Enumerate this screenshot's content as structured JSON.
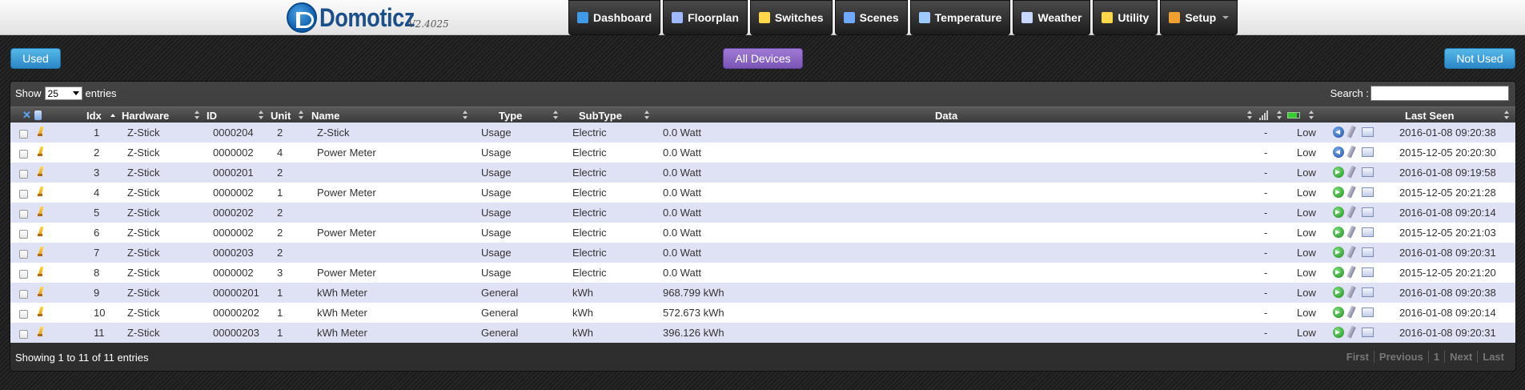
{
  "brand": {
    "name": "Domoticz",
    "version": "V2.4025"
  },
  "nav": [
    {
      "label": "Dashboard",
      "icon": "dashboard-icon",
      "color": "#3f9be8"
    },
    {
      "label": "Floorplan",
      "icon": "floorplan-icon",
      "color": "#9fb8ff"
    },
    {
      "label": "Switches",
      "icon": "switches-icon",
      "color": "#ffd84a"
    },
    {
      "label": "Scenes",
      "icon": "scenes-icon",
      "color": "#6fa8ff"
    },
    {
      "label": "Temperature",
      "icon": "temperature-icon",
      "color": "#9ecbff"
    },
    {
      "label": "Weather",
      "icon": "weather-icon",
      "color": "#c8d8ff"
    },
    {
      "label": "Utility",
      "icon": "utility-icon",
      "color": "#ffd84a"
    },
    {
      "label": "Setup",
      "icon": "setup-icon",
      "color": "#f0a030"
    }
  ],
  "buttons": {
    "used": "Used",
    "all": "All Devices",
    "not_used": "Not Used"
  },
  "table_controls": {
    "show": "Show",
    "entries_value": "25",
    "entries": "entries",
    "search": "Search :"
  },
  "columns": {
    "idx": "Idx",
    "hardware": "Hardware",
    "id": "ID",
    "unit": "Unit",
    "name": "Name",
    "type": "Type",
    "subtype": "SubType",
    "data": "Data",
    "last_seen": "Last Seen"
  },
  "rows": [
    {
      "idx": "1",
      "hardware": "Z-Stick",
      "id": "0000204",
      "unit": "2",
      "name": "Z-Stick",
      "type": "Usage",
      "subtype": "Electric",
      "data": "0.0 Watt",
      "signal": "-",
      "battery": "Low",
      "arrow": "blue",
      "last_seen": "2016-01-08 09:20:38"
    },
    {
      "idx": "2",
      "hardware": "Z-Stick",
      "id": "0000002",
      "unit": "4",
      "name": "Power Meter",
      "type": "Usage",
      "subtype": "Electric",
      "data": "0.0 Watt",
      "signal": "-",
      "battery": "Low",
      "arrow": "blue",
      "last_seen": "2015-12-05 20:20:30"
    },
    {
      "idx": "3",
      "hardware": "Z-Stick",
      "id": "0000201",
      "unit": "2",
      "name": "",
      "type": "Usage",
      "subtype": "Electric",
      "data": "0.0 Watt",
      "signal": "-",
      "battery": "Low",
      "arrow": "green",
      "last_seen": "2016-01-08 09:19:58"
    },
    {
      "idx": "4",
      "hardware": "Z-Stick",
      "id": "0000002",
      "unit": "1",
      "name": "Power Meter",
      "type": "Usage",
      "subtype": "Electric",
      "data": "0.0 Watt",
      "signal": "-",
      "battery": "Low",
      "arrow": "green",
      "last_seen": "2015-12-05 20:21:28"
    },
    {
      "idx": "5",
      "hardware": "Z-Stick",
      "id": "0000202",
      "unit": "2",
      "name": "",
      "type": "Usage",
      "subtype": "Electric",
      "data": "0.0 Watt",
      "signal": "-",
      "battery": "Low",
      "arrow": "green",
      "last_seen": "2016-01-08 09:20:14"
    },
    {
      "idx": "6",
      "hardware": "Z-Stick",
      "id": "0000002",
      "unit": "2",
      "name": "Power Meter",
      "type": "Usage",
      "subtype": "Electric",
      "data": "0.0 Watt",
      "signal": "-",
      "battery": "Low",
      "arrow": "green",
      "last_seen": "2015-12-05 20:21:03"
    },
    {
      "idx": "7",
      "hardware": "Z-Stick",
      "id": "0000203",
      "unit": "2",
      "name": "",
      "type": "Usage",
      "subtype": "Electric",
      "data": "0.0 Watt",
      "signal": "-",
      "battery": "Low",
      "arrow": "green",
      "last_seen": "2016-01-08 09:20:31"
    },
    {
      "idx": "8",
      "hardware": "Z-Stick",
      "id": "0000002",
      "unit": "3",
      "name": "Power Meter",
      "type": "Usage",
      "subtype": "Electric",
      "data": "0.0 Watt",
      "signal": "-",
      "battery": "Low",
      "arrow": "green",
      "last_seen": "2015-12-05 20:21:20"
    },
    {
      "idx": "9",
      "hardware": "Z-Stick",
      "id": "00000201",
      "unit": "1",
      "name": "kWh Meter",
      "type": "General",
      "subtype": "kWh",
      "data": "968.799 kWh",
      "signal": "-",
      "battery": "Low",
      "arrow": "green",
      "last_seen": "2016-01-08 09:20:38"
    },
    {
      "idx": "10",
      "hardware": "Z-Stick",
      "id": "00000202",
      "unit": "1",
      "name": "kWh Meter",
      "type": "General",
      "subtype": "kWh",
      "data": "572.673 kWh",
      "signal": "-",
      "battery": "Low",
      "arrow": "green",
      "last_seen": "2016-01-08 09:20:14"
    },
    {
      "idx": "11",
      "hardware": "Z-Stick",
      "id": "00000203",
      "unit": "1",
      "name": "kWh Meter",
      "type": "General",
      "subtype": "kWh",
      "data": "396.126 kWh",
      "signal": "-",
      "battery": "Low",
      "arrow": "green",
      "last_seen": "2016-01-08 09:20:31"
    }
  ],
  "footer": {
    "info": "Showing 1 to 11 of 11 entries",
    "pager": {
      "first": "First",
      "previous": "Previous",
      "page": "1",
      "next": "Next",
      "last": "Last"
    }
  }
}
